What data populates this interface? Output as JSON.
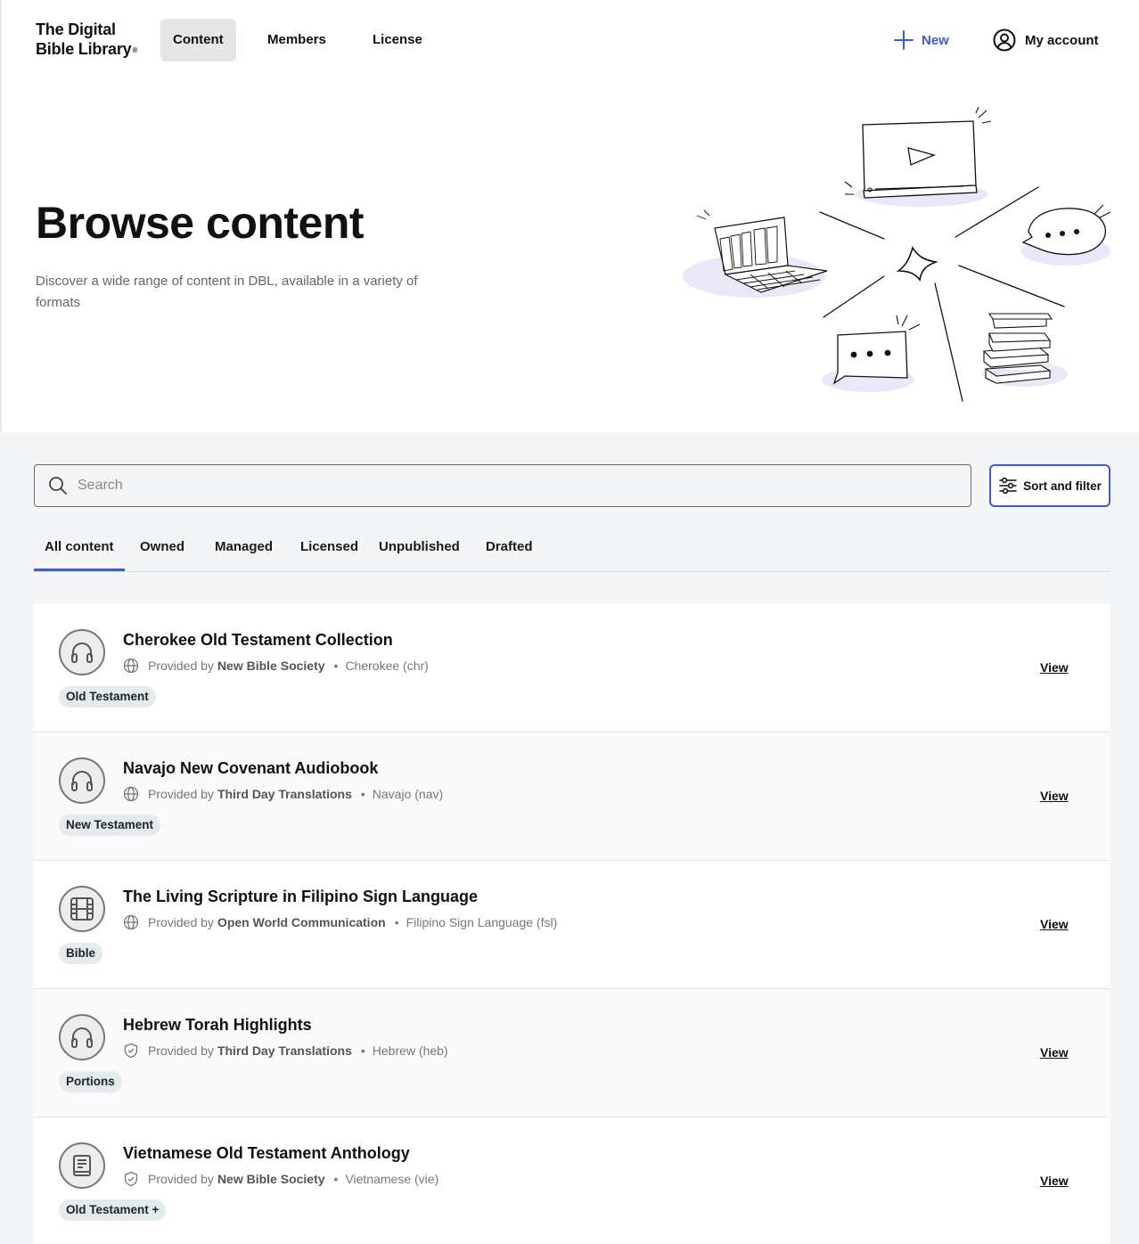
{
  "header": {
    "logo_line1": "The Digital",
    "logo_line2": "Bible Library",
    "logo_reg": "®",
    "nav": [
      "Content",
      "Members",
      "License"
    ],
    "new_label": "New",
    "account_label": "My account"
  },
  "hero": {
    "title": "Browse content",
    "description": "Discover a wide range of content in DBL, available in a variety of formats"
  },
  "search": {
    "placeholder": "Search"
  },
  "sort_filter_label": "Sort and filter",
  "tabs": [
    "All content",
    "Owned",
    "Managed",
    "Licensed",
    "Unpublished",
    "Drafted"
  ],
  "active_tab": "All content",
  "items": [
    {
      "title": "Cherokee Old Testament Collection",
      "provided_by": "Provided by",
      "provider": "New Bible Society",
      "language": "Cherokee (chr)",
      "tag": "Old Testament",
      "media_icon": "headphones-icon",
      "meta_icon": "globe-icon",
      "view": "View"
    },
    {
      "title": "Navajo New Covenant Audiobook",
      "provided_by": "Provided by",
      "provider": "Third Day Translations",
      "language": "Navajo (nav)",
      "tag": "New Testament",
      "media_icon": "headphones-icon",
      "meta_icon": "globe-icon",
      "view": "View"
    },
    {
      "title": "The Living Scripture in Filipino Sign Language",
      "provided_by": "Provided by",
      "provider": "Open World Communication",
      "language": "Filipino Sign Language (fsl)",
      "tag": "Bible",
      "media_icon": "film-icon",
      "meta_icon": "globe-icon",
      "view": "View"
    },
    {
      "title": "Hebrew Torah Highlights",
      "provided_by": "Provided by",
      "provider": "Third Day Translations",
      "language": "Hebrew (heb)",
      "tag": "Portions",
      "media_icon": "headphones-icon",
      "meta_icon": "shield-check-icon",
      "view": "View"
    },
    {
      "title": "Vietnamese Old Testament Anthology",
      "provided_by": "Provided by",
      "provider": "New Bible Society",
      "language": "Vietnamese (vie)",
      "tag": "Old Testament +",
      "media_icon": "book-icon",
      "meta_icon": "shield-check-icon",
      "view": "View"
    }
  ],
  "colors": {
    "accent": "#3b5bdb",
    "tag_bg": "#e2ecec",
    "page_bg": "#f4f5f7"
  }
}
